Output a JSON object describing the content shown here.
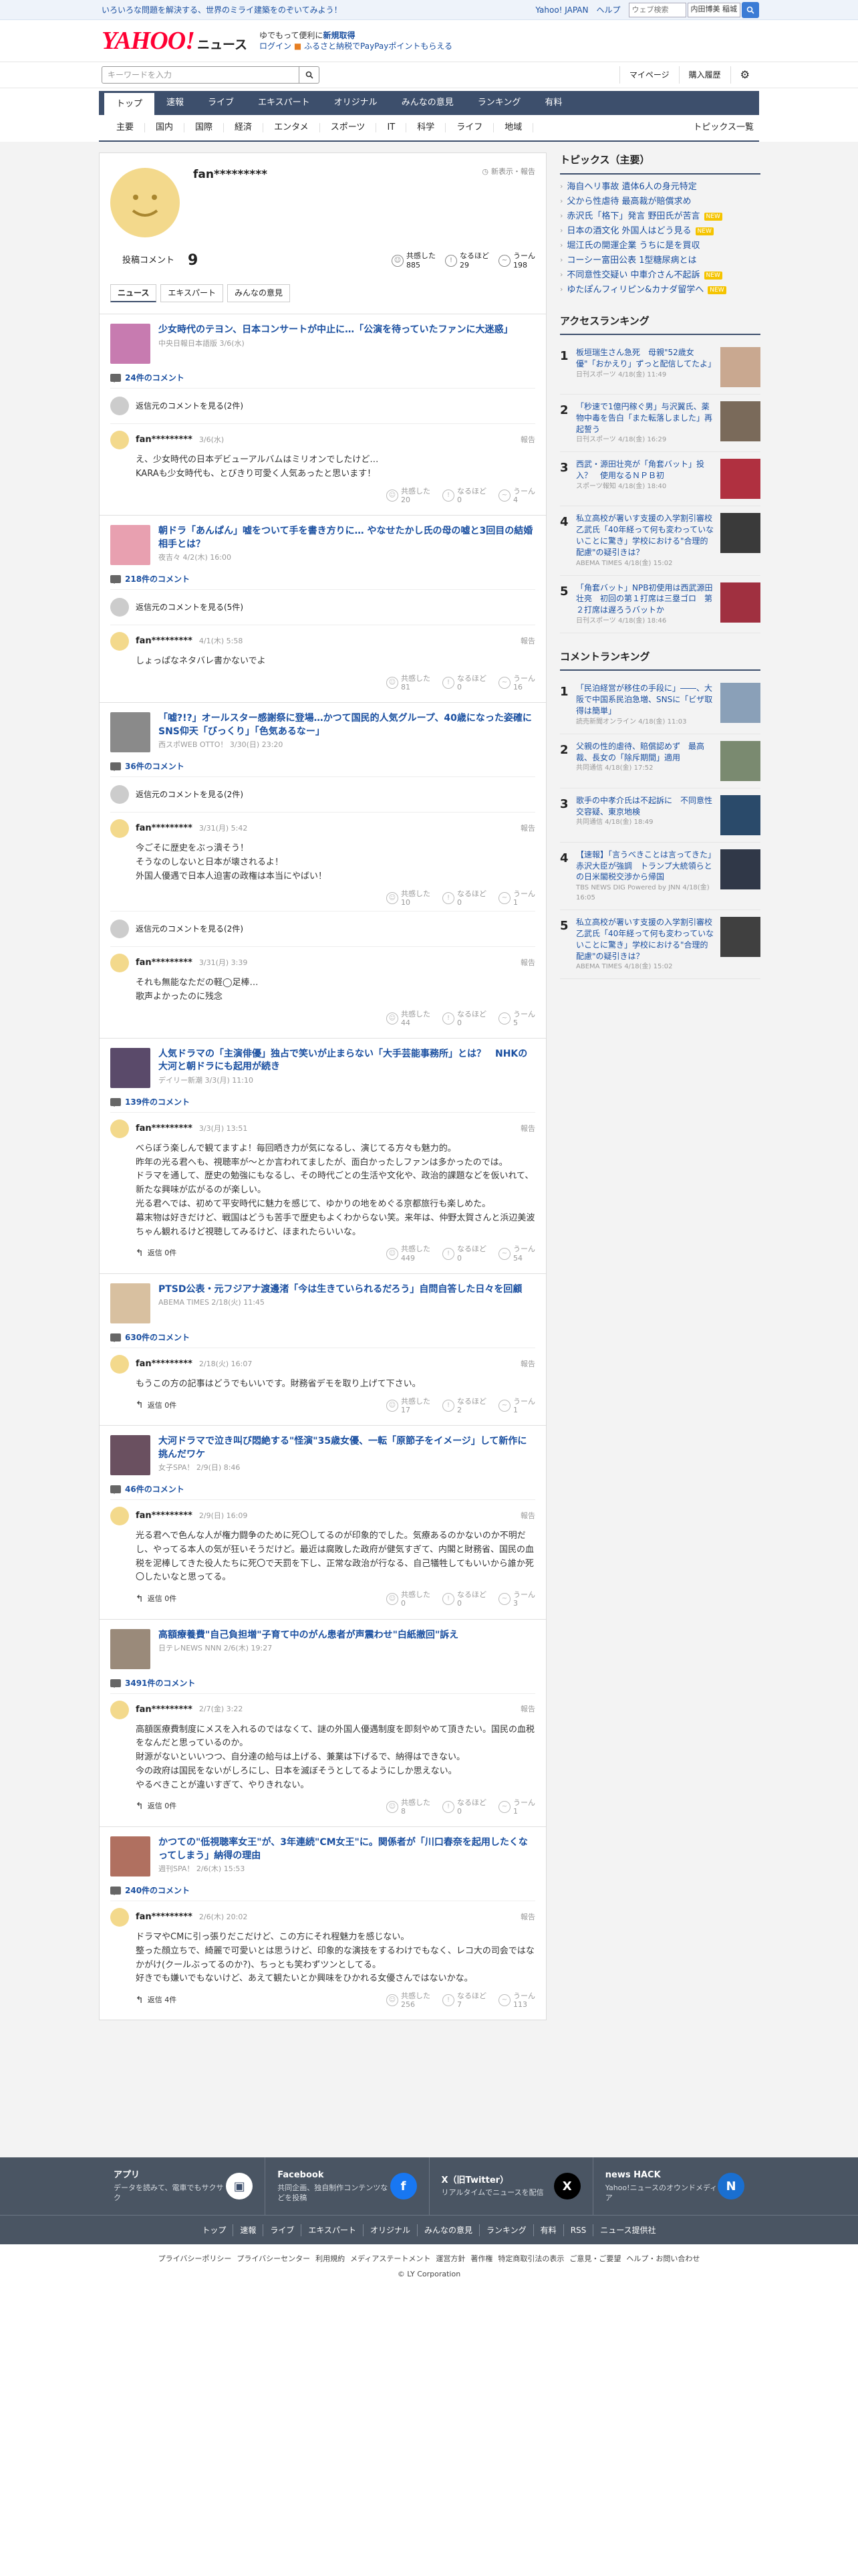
{
  "topstrip": {
    "tagline": "いろいろな問題を解決する、世界のミライ建築をのぞいてみよう！",
    "yahoo_japan": "Yahoo! JAPAN",
    "help": "ヘルプ",
    "web_search_placeholder": "ウェブ検索",
    "location": "内田博美",
    "location_sub": "稲城"
  },
  "header": {
    "logo": "YAHOO!",
    "logo_sub": "ニュース",
    "promo_line1_a": "ゆでもって便利に",
    "promo_line1_b": "新規取得",
    "promo_line2_a": "ログイン",
    "promo_line2_b": "ふるさと納税でPayPayポイントもらえる"
  },
  "searchrow": {
    "placeholder": "キーワードを入力",
    "mypage": "マイページ",
    "history": "購入履歴"
  },
  "gnav": [
    "トップ",
    "速報",
    "ライブ",
    "エキスパート",
    "オリジナル",
    "みんなの意見",
    "ランキング",
    "有料"
  ],
  "subnav": [
    "主要",
    "国内",
    "国際",
    "経済",
    "エンタメ",
    "スポーツ",
    "IT",
    "科学",
    "ライフ",
    "地域"
  ],
  "subnav_right": "トピックス一覧",
  "profile": {
    "name": "fan*********",
    "display": "新表示・報告",
    "comments_label": "投稿コメント",
    "comments_count": "9",
    "empathy_label": "共感した",
    "empathy_count": "885",
    "naruhodo_label": "なるほど",
    "naruhodo_count": "29",
    "uun_label": "うーん",
    "uun_count": "198"
  },
  "tabs": [
    "ニュース",
    "エキスパート",
    "みんなの意見"
  ],
  "ui": {
    "prev_comment": "返信元のコメントを見る",
    "report": "報告",
    "reply": "返信",
    "empathy": "共感した",
    "naruhodo": "なるほど",
    "uun": "うーん",
    "comment_suffix": "件のコメント"
  },
  "articles": [
    {
      "title": "少女時代のテヨン、日本コンサートが中止に…「公演を待っていたファンに大迷惑」",
      "source": "中央日報日本語版 3/6(水)",
      "count": "24件のコメント",
      "blocks": [
        {
          "prev": "返信元のコメントを見る(2件)"
        },
        {
          "user": "fan*********",
          "date": "3/6(水)",
          "text": "え、少女時代の日本デビューアルバムはミリオンでしたけど…\nKARAも少女時代も、とびきり可愛く人気あったと思います！",
          "reply": "",
          "v": [
            "20",
            "0",
            "4"
          ]
        }
      ]
    },
    {
      "title": "朝ドラ「あんぱん」嘘をついて手を書き方りに… やなせたかし氏の母の嘘と3回目の結婚相手とは？",
      "source": "夜吉々 4/2(木) 16:00",
      "count": "218件のコメント",
      "blocks": [
        {
          "prev": "返信元のコメントを見る(5件)"
        },
        {
          "user": "fan*********",
          "date": "4/1(木) 5:58",
          "text": "しょっぱなネタバレ書かないでよ",
          "reply": "",
          "v": [
            "81",
            "0",
            "16"
          ]
        }
      ]
    },
    {
      "title": "「嘘?!?」オールスター感謝祭に登場…かつて国民的人気グループ、40歳になった姿確に SNS仰天「びっくり」「色気あるなー」",
      "source": "西スポWEB OTTO！ 3/30(日) 23:20",
      "count": "36件のコメント",
      "blocks": [
        {
          "prev": "返信元のコメントを見る(2件)"
        },
        {
          "user": "fan*********",
          "date": "3/31(月) 5:42",
          "text": "今ごそに歴史をぶっ潰そう！\nそうなのしないと日本が壊されるよ！\n外国人優遇で日本人迫害の政権は本当にやばい！",
          "reply": "",
          "v": [
            "10",
            "0",
            "1"
          ]
        },
        {
          "prev": "返信元のコメントを見る(2件)"
        },
        {
          "user": "fan*********",
          "date": "3/31(月) 3:39",
          "text": "それも無能なただの軽◯足棒…\n歌声よかったのに残念",
          "reply": "",
          "v": [
            "44",
            "0",
            "5"
          ]
        }
      ]
    },
    {
      "title": "人気ドラマの「主演俳優」独占で笑いが止まらない「大手芸能事務所」とは？　NHKの大河と朝ドラにも起用が続き",
      "source": "デイリー新潮 3/3(月) 11:10",
      "count": "139件のコメント",
      "blocks": [
        {
          "user": "fan*********",
          "date": "3/3(月) 13:51",
          "text": "べらぼう楽しんで観てますよ！毎回晒き力が気になるし、演じてる方々も魅力的。\n昨年の光る君へも、視聴率が〜とか言われてましたが、面白かったしファンは多かったのでは。\nドラマを通して、歴史の勉強にもなるし、その時代ごとの生活や文化や、政治的課題などを仮いれて、新たな興味が広がるのが楽しい。\n光る君へでは、初めて平安時代に魅力を感じて、ゆかりの地をめぐる京都旅行も楽しめた。\n幕末物は好きだけど、戦国はどうも苦手で歴史もよくわからない笑。来年は、仲野太賀さんと浜辺美波ちゃん観れるけど視聴してみるけど、ほまれたらいいな。",
          "reply": "返信 0件",
          "v": [
            "449",
            "0",
            "54"
          ]
        }
      ]
    },
    {
      "title": "PTSD公表・元フジアナ渡邊渚「今は生きていられるだろう」自問自答した日々を回顧",
      "source": "ABEMA TIMES 2/18(火) 11:45",
      "count": "630件のコメント",
      "blocks": [
        {
          "user": "fan*********",
          "date": "2/18(火) 16:07",
          "text": "もうこの方の記事はどうでもいいです。財務省デモを取り上げて下さい。",
          "reply": "返信 0件",
          "v": [
            "17",
            "2",
            "1"
          ]
        }
      ]
    },
    {
      "title": "大河ドラマで泣き叫び悶絶する\"怪演\"35歳女優、一転「原節子をイメージ」して新作に挑んだワケ",
      "source": "女子SPA！ 2/9(日) 8:46",
      "count": "46件のコメント",
      "blocks": [
        {
          "user": "fan*********",
          "date": "2/9(日) 16:09",
          "text": "光る君へで色んな人が権力闘争のために死〇してるのが印象的でした。気療あるのかないのか不明だし、やってる本人の気が狂いそうだけど。最近は腐敗した政府が健気すぎて、内閣と財務省、国民の血税を泥棒してきた役人たちに死〇で天罰を下し、正常な政治が行なる、自己犠牲してもいいから誰か死〇したいなと思ってる。",
          "reply": "返信 0件",
          "v": [
            "0",
            "0",
            "3"
          ]
        }
      ]
    },
    {
      "title": "高額療養費\"自己負担増\"子育て中のがん患者が声震わせ\"白紙撤回\"訴え",
      "source": "日テレNEWS NNN 2/6(木) 19:27",
      "count": "3491件のコメント",
      "blocks": [
        {
          "user": "fan*********",
          "date": "2/7(金) 3:22",
          "text": "高額医療費制度にメスを入れるのではなくて、謎の外国人優遇制度を即刻やめて頂きたい。国民の血税をなんだと思っているのか。\n財源がないといいつつ、自分達の給与は上げる、兼業は下げるで、納得はできない。\n今の政府は国民をないがしろにし、日本を滅ぼそうとしてるようにしか思えない。\nやるべきことが違いすぎて、やりきれない。",
          "reply": "返信 0件",
          "v": [
            "8",
            "0",
            "1"
          ]
        }
      ]
    },
    {
      "title": "かつての\"低視聴率女王\"が、3年連続\"CM女王\"に。関係者が「川口春奈を起用したくなってしまう」納得の理由",
      "source": "週刊SPA！ 2/6(木) 15:53",
      "count": "240件のコメント",
      "blocks": [
        {
          "user": "fan*********",
          "date": "2/6(木) 20:02",
          "text": "ドラマやCMに引っ張りだこだけど、この方にそれ程魅力を感じない。\n整った顔立ちで、綺麗で可愛いとは思うけど、印象的な演技をするわけでもなく、レコ大の司会ではなかがけ(クールぶってるのか?)、ちっとも笑わずツンとしてる。\n好きでも嫌いでもないけど、あえて観たいとか興味をひかれる女優さんではないかな。",
          "reply": "返信 4件",
          "v": [
            "256",
            "7",
            "113"
          ]
        }
      ]
    }
  ],
  "sidebar": {
    "topics_title": "トピックス（主要）",
    "topics": [
      {
        "t": "海自ヘリ事故 遺体6人の身元特定",
        "b": ""
      },
      {
        "t": "父から性虐待 最高裁が賠償求め",
        "b": ""
      },
      {
        "t": "赤沢氏「格下」発言 野田氏が苦言",
        "b": "NEW"
      },
      {
        "t": "日本の酒文化 外国人はどう見る",
        "b": "NEW"
      },
      {
        "t": "堀江氏の開運企業 うちに是を買収",
        "b": ""
      },
      {
        "t": "コーシー富田公表 1型糖尿病とは",
        "b": ""
      },
      {
        "t": "不同意性交疑い 中車介さん不起訴",
        "b": "NEW"
      },
      {
        "t": "ゆたぽんフィリピン&カナダ留学へ",
        "b": "NEW"
      }
    ],
    "access_title": "アクセスランキング",
    "access": [
      {
        "n": "1",
        "t": "板垣瑞生さん急死　母親\"52歳女優\"「おかえり」ずっと配信してたよ」",
        "s": "日刊スポーツ 4/18(金) 11:49"
      },
      {
        "n": "2",
        "t": "「秒速で1億円稼ぐ男」与沢翼氏、薬物中毒を告白「また転落しました」再起誓う",
        "s": "日刊スポーツ 4/18(金) 16:29"
      },
      {
        "n": "3",
        "t": "西武・源田壮亮が「角套バット」投入？　使用なるＮＰＢ初",
        "s": "スポーツ報知 4/18(金) 18:40"
      },
      {
        "n": "4",
        "t": "私立高校が署いす支援の入学割引審校 乙武氏「40年経って何も変わっていないことに驚き」学校における\"合理的配慮\"の疑引きは？",
        "s": "ABEMA TIMES 4/18(金) 15:02"
      },
      {
        "n": "5",
        "t": "「角套バット」NPB初使用は西武源田壮亮　初回の第１打席は三塁ゴロ　第２打席は遅ろうバットか",
        "s": "日刊スポーツ 4/18(金) 18:46"
      }
    ],
    "comment_title": "コメントランキング",
    "comment": [
      {
        "n": "1",
        "t": "「民泊経営が移住の手段に」――、大阪で中国系民泊急増、SNSに「ビザ取得は簡単」",
        "s": "読売新聞オンライン 4/18(金) 11:03"
      },
      {
        "n": "2",
        "t": "父親の性的虐待、賠償認めず　最高裁、長女の「除斥期間」適用",
        "s": "共同通信 4/18(金) 17:52"
      },
      {
        "n": "3",
        "t": "歌手の中孝介氏は不起訴に　不同意性交容疑、東京地検",
        "s": "共同通信 4/18(金) 18:49"
      },
      {
        "n": "4",
        "t": "【速報】「言うべきことは言ってきた」赤沢大臣が強調　トランプ大統領らとの日米閣税交渉から帰国",
        "s": "TBS NEWS DIG Powered by JNN 4/18(金) 16:05"
      },
      {
        "n": "5",
        "t": "私立高校が署いす支援の入学割引審校 乙武氏「40年経って何も変わっていないことに驚き」学校における\"合理的配慮\"の疑引きは？",
        "s": "ABEMA TIMES 4/18(金) 15:02"
      }
    ]
  },
  "footer": {
    "cards": [
      {
        "t": "アプリ",
        "d": "データを読みて、電車でもサクサク",
        "ic": "app-icon"
      },
      {
        "t": "Facebook",
        "d": "共同企画、独自制作コンテンツなどを投稿",
        "ic": "facebook-icon"
      },
      {
        "t": "X（旧Twitter）",
        "d": "リアルタイムでニュースを配信",
        "ic": "x-icon"
      },
      {
        "t": "news HACK",
        "d": "Yahoo!ニュースのオウンドメディア",
        "ic": "newshack-icon"
      }
    ],
    "links": [
      "トップ",
      "速報",
      "ライブ",
      "エキスパート",
      "オリジナル",
      "みんなの意見",
      "ランキング",
      "有料",
      "RSS",
      "ニュース提供社"
    ],
    "legal": [
      "プライバシーポリシー",
      "プライバシーセンター",
      "利用規約",
      "メディアステートメント",
      "運営方針",
      "著作権",
      "特定商取引法の表示",
      "ご意見・ご要望",
      "ヘルプ・お問い合わせ"
    ],
    "copyright": "© LY Corporation"
  },
  "colors": {
    "nav": "#3d4f6c",
    "link": "#1a4fa0",
    "brand": "#ff0033"
  }
}
